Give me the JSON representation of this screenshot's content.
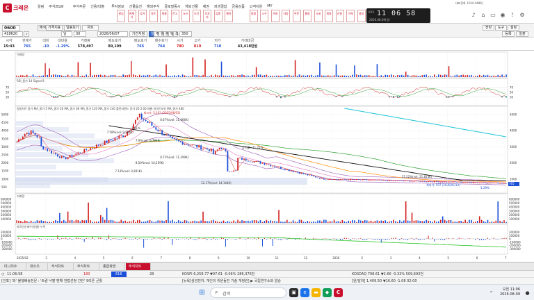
{
  "app": {
    "logo_text": "크레온",
    "menu": [
      "알림",
      "주식/ELW",
      "주식주문",
      "신용/대출",
      "투자정보",
      "선물옵션",
      "해외주식",
      "글로벌증시",
      "해외선물",
      "채권",
      "파생결합",
      "금융상품",
      "고객지원",
      "MY"
    ],
    "quick_buttons": [
      "관심",
      "현재가",
      "호가",
      "차트",
      "체결",
      "잔고",
      "뉴스",
      "조건",
      "투자자",
      "업종",
      "예약",
      "종합",
      "소수",
      "거래",
      "자동",
      "주문",
      "통합",
      "시세",
      "계좌",
      "신용",
      "이체",
      "설정"
    ],
    "clock": {
      "time": "11 06 58",
      "date": "2026.08.09(일)",
      "badge": "KRX"
    },
    "phone": "대표전화 1544-4488 |"
  },
  "toolbar": {
    "screen_no": "0600",
    "screen_name": "주식차트",
    "stock_code": "418620",
    "search_icon": "search-icon",
    "period_select": "일",
    "period_count": "30",
    "date": "2026/06/07",
    "range_label": "기간지정",
    "unit_buttons": [
      "일",
      "주",
      "월",
      "분",
      "틱",
      "초"
    ],
    "count_value": "350",
    "right_buttons": [
      "전략",
      "도구",
      "설정"
    ],
    "sub_buttons": [
      "종목추가",
      "가격지표",
      "일봉보기",
      "차트"
    ],
    "far_right": [
      "등록",
      "일괄"
    ]
  },
  "quote": {
    "columns": [
      {
        "h": "시각",
        "v": "15:43",
        "cls": ""
      },
      {
        "h": "현재가",
        "v": "765",
        "cls": "down"
      },
      {
        "h": "대비",
        "v": "-10",
        "cls": "down"
      },
      {
        "h": "대비율",
        "v": "-1.29%",
        "cls": "down"
      },
      {
        "h": "거래량",
        "v": "578,497",
        "cls": ""
      },
      {
        "h": "매도호가",
        "v": "89,109",
        "cls": ""
      },
      {
        "h": "매도호가",
        "v": "765",
        "cls": "down"
      },
      {
        "h": "매수호가",
        "v": "764",
        "cls": "down"
      },
      {
        "h": "시가",
        "v": "780",
        "cls": "up"
      },
      {
        "h": "고가",
        "v": "810",
        "cls": "up"
      },
      {
        "h": "저가",
        "v": "710",
        "cls": "down"
      },
      {
        "h": "거래대금",
        "v": "43,418만원",
        "cls": ""
      }
    ]
  },
  "chart": {
    "panel1_legend": "거래량",
    "panel2_legend": "RSI_종가 14 Signal 9",
    "panel3_legend": "일봉차트 종가 MA_종가 5 MA_종가 20 MA_종가 60 MA_종가 120 MA_종가 240 볼린저밴드 종가 20 2.00 매물 외국인보유 MA_종가 480",
    "panel4_legend": "거래량",
    "panel5_legend": "외국인순매수(일별) 누적",
    "price_ticks": [
      "5000",
      "4500",
      "4000",
      "3500",
      "3000",
      "2500",
      "2000",
      "1500",
      "1000",
      "500"
    ],
    "rsi_ticks": [
      "70",
      "50",
      "30"
    ],
    "vol_ticks": [
      "600000",
      "500000",
      "400000",
      "300000",
      "200000",
      "100000"
    ],
    "net_ticks": [
      "200000",
      "100000",
      "0",
      "-100000",
      "-200000",
      "-300000"
    ],
    "x_labels": [
      "2025/02",
      "3",
      "4",
      "5",
      "6",
      "7",
      "8",
      "9",
      "10",
      "11",
      "12",
      "2026",
      "2",
      "3",
      "4",
      "5",
      "6",
      "7"
    ],
    "annotations": [
      {
        "text": "최고가: 5,163 (2025/06/03)",
        "color": "#d21e1e"
      },
      {
        "text": "7.41%",
        "color": "#333"
      },
      {
        "text": "8.67%(vol: 11,666K)",
        "color": "#333"
      },
      {
        "text": "7.58%(vol: 9,580K)",
        "color": "#333"
      },
      {
        "text": "7.9%(vol: 9,784K)",
        "color": "#333"
      },
      {
        "text": "8.72%(vol: 11,299K)",
        "color": "#333"
      },
      {
        "text": "8.50%(vol: 10,259K)",
        "color": "#333"
      },
      {
        "text": "7.13%(vol: 9,281K)",
        "color": "#333"
      },
      {
        "text": "12.17%(vol: 14,144K)",
        "color": "#333"
      },
      {
        "text": "26.33%(vol: 38,000K)",
        "color": "#333"
      },
      {
        "text": "27.22%(vol: 21,823K)",
        "color": "#333"
      },
      {
        "text": "최저가: 597 (2026/05/12)",
        "color": "#1b4fd8"
      },
      {
        "text": "등락률: -11.25%",
        "color": "#333"
      },
      {
        "text": "-1.29%",
        "color": "#1b4fd8"
      },
      {
        "text": "765",
        "color": "#fff"
      }
    ]
  },
  "bottom_tabs": [
    "미니지수",
    "대소조",
    "주식차트",
    "주식차트",
    "종합화면",
    "주식차트"
  ],
  "status": {
    "time": "11:06:58",
    "kospi": "KOSPI 6,258.77 ▼97.61 -0.06% 286,376천",
    "kosdaq": "KOSDAQ 798.61 ▼2.66 -0.33% 509,693천",
    "val_a": "180",
    "val_b": "616",
    "val_c": "28",
    "news1": "[인포] '와' 불행배송전문 : '트럼 낙팔 멘해 전접선정 간단' 9리픈 군활",
    "news2": "[뉴욕]삼성전자, 개인의 위원들진 기술 개정원] ▶ 국립연구소와 알승",
    "fx": "[원/달러] 1,409.50 ▼16.60 -1.08 02:00"
  },
  "taskbar": {
    "search_placeholder": "검색",
    "time": "오전 11:06",
    "date": "2026-08-09"
  }
}
